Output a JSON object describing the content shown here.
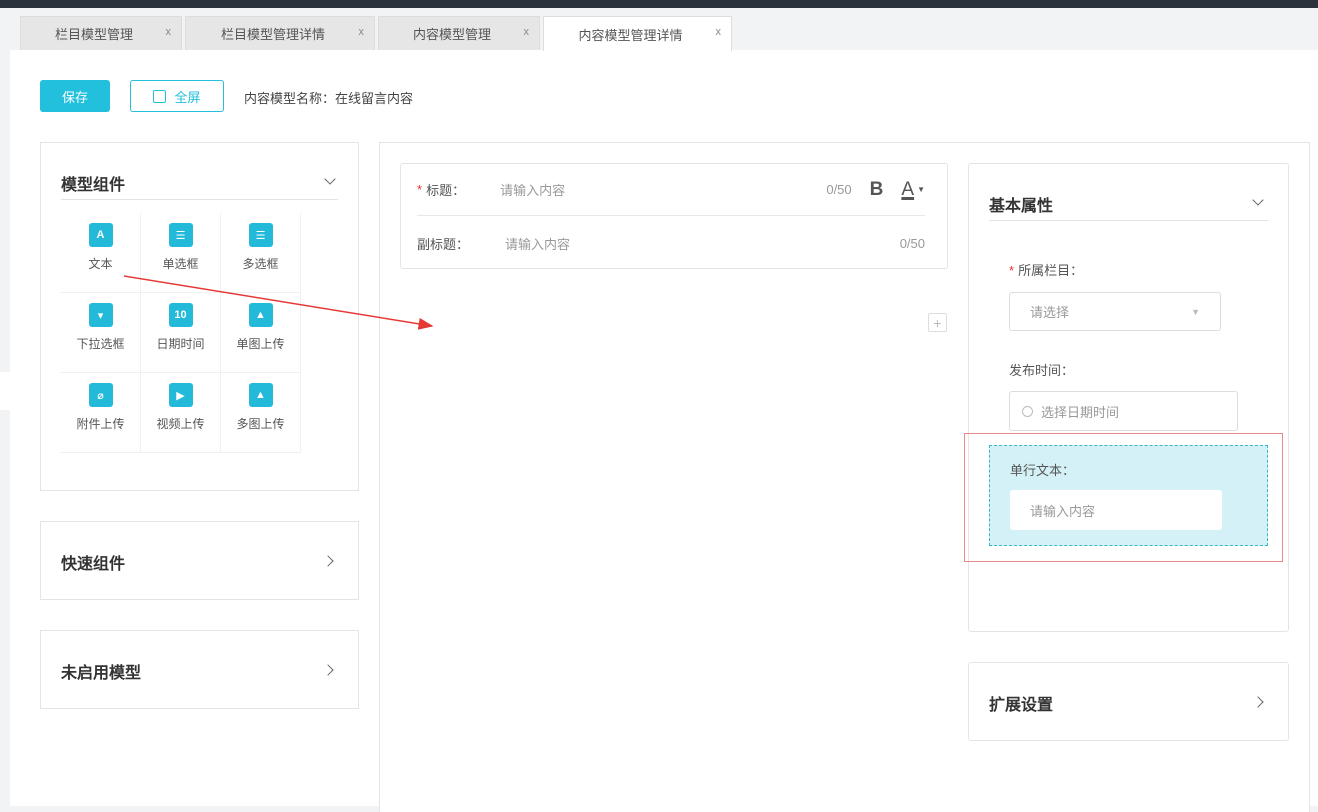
{
  "tabs": [
    {
      "label": "栏目模型管理",
      "close": "x"
    },
    {
      "label": "栏目模型管理详情",
      "close": "x"
    },
    {
      "label": "内容模型管理",
      "close": "x"
    },
    {
      "label": "内容模型管理详情",
      "close": "x",
      "active": true
    }
  ],
  "toolbar": {
    "save": "保存",
    "fullscreen": "全屏",
    "model_name": "内容模型名称：在线留言内容"
  },
  "left": {
    "components_title": "模型组件",
    "components": [
      {
        "label": "文本",
        "icon": "text-icon",
        "glyph": "A"
      },
      {
        "label": "单选框",
        "icon": "radio-icon",
        "glyph": "☰"
      },
      {
        "label": "多选框",
        "icon": "checkbox-icon",
        "glyph": "☰"
      },
      {
        "label": "下拉选框",
        "icon": "dropdown-icon",
        "glyph": "▾"
      },
      {
        "label": "日期时间",
        "icon": "calendar-icon",
        "glyph": "10"
      },
      {
        "label": "单图上传",
        "icon": "image-upload-icon",
        "glyph": "▲"
      },
      {
        "label": "附件上传",
        "icon": "attachment-icon",
        "glyph": "⌀"
      },
      {
        "label": "视频上传",
        "icon": "video-icon",
        "glyph": "▶"
      },
      {
        "label": "多图上传",
        "icon": "multi-image-icon",
        "glyph": "▲"
      }
    ],
    "quick_title": "快速组件",
    "disabled_title": "未启用模型"
  },
  "center": {
    "title_label": "标题：",
    "title_placeholder": "请输入内容",
    "title_count": "0/50",
    "bold": "B",
    "font_color": "A",
    "subtitle_label": "副标题：",
    "subtitle_placeholder": "请输入内容",
    "subtitle_count": "0/50",
    "add": "+"
  },
  "right": {
    "basic_title": "基本属性",
    "column_label": "所属栏目：",
    "column_placeholder": "请选择",
    "time_label": "发布时间：",
    "time_placeholder": "选择日期时间",
    "text_label": "单行文本：",
    "text_placeholder": "请输入内容",
    "ext_title": "扩展设置"
  },
  "colors": {
    "accent": "#23c0de",
    "required": "#e33333",
    "drop_bg": "#d3f1f6",
    "highlight": "#e57373"
  }
}
